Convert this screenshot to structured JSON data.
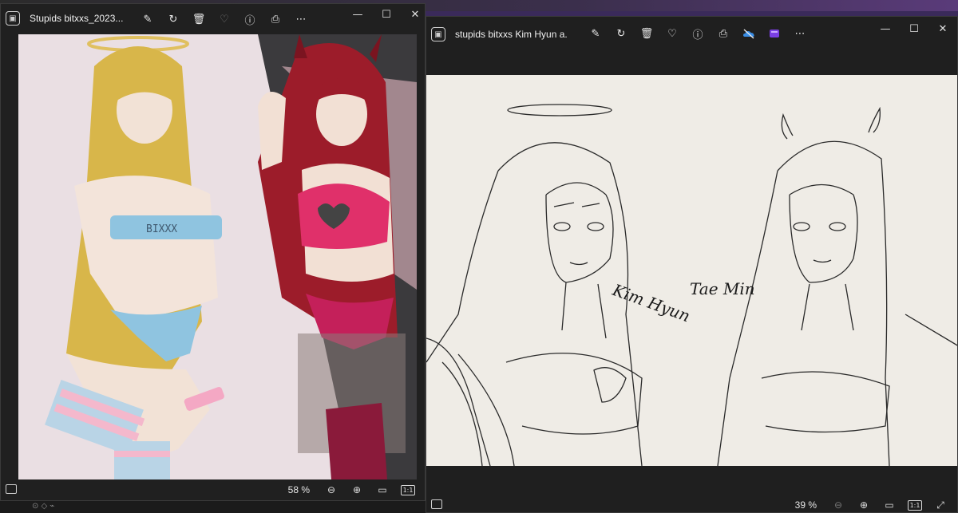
{
  "left_window": {
    "title": "Stupids bitxxs_2023...",
    "zoom": "58 %",
    "tool_icons": [
      "edit-image-icon",
      "rotate-icon",
      "delete-icon",
      "favorite-icon",
      "info-icon",
      "print-icon",
      "more-icon"
    ],
    "top_label": "BIXXX"
  },
  "right_window": {
    "title": "stupids bitxxs Kim Hyun a...",
    "zoom": "39 %",
    "tool_icons": [
      "edit-image-icon",
      "rotate-icon",
      "delete-icon",
      "favorite-icon",
      "info-icon",
      "print-icon",
      "onedrive-icon",
      "clipchamp-icon",
      "more-icon"
    ],
    "sketch_labels": {
      "left_name": "Kim Hyun",
      "right_name": "Tae Min"
    }
  },
  "colors": {
    "window_bg": "#202020",
    "blonde_hair": "#d8b64a",
    "red_hair": "#9c1c2a",
    "pink_top": "#e0306a",
    "blue_top": "#8fc4e0"
  }
}
